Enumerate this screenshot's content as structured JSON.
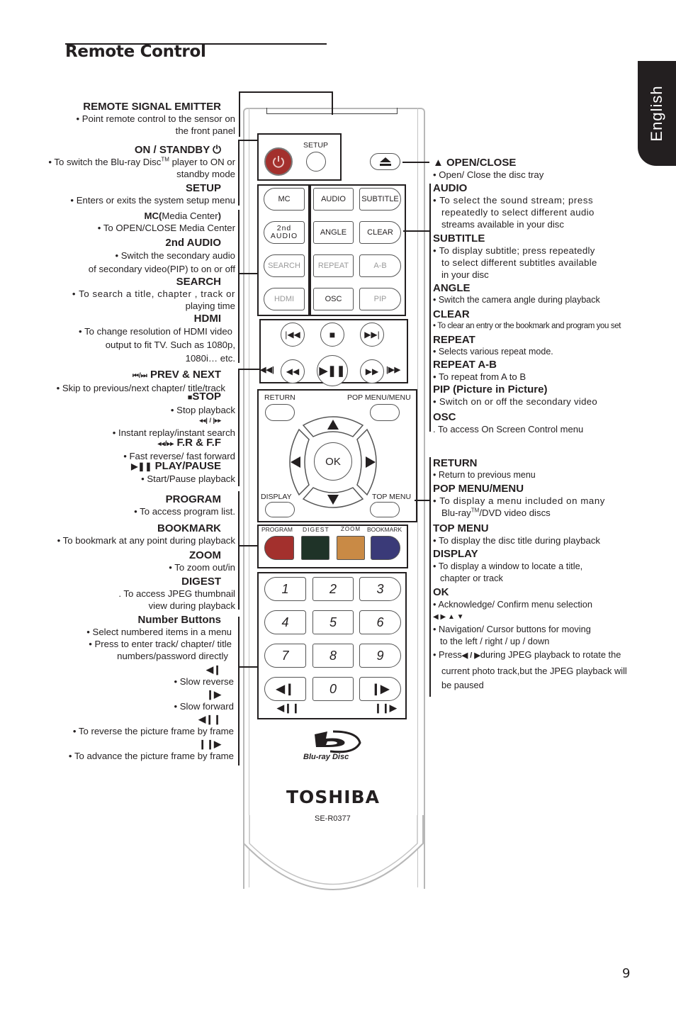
{
  "page": {
    "title": "Remote Control",
    "language_tab": "English",
    "page_number": "9"
  },
  "remote": {
    "setup_label": "SETUP",
    "buttons_left": [
      "MC",
      "2nd AUDIO",
      "SEARCH",
      "HDMI"
    ],
    "mc": "MC",
    "second_audio_1": "2nd",
    "second_audio_2": "AUDIO",
    "search": "SEARCH",
    "hdmi": "HDMI",
    "audio": "AUDIO",
    "subtitle": "SUBTITLE",
    "angle": "ANGLE",
    "clear": "CLEAR",
    "repeat": "REPEAT",
    "ab": "A-B",
    "osc": "OSC",
    "pip": "PIP",
    "return": "RETURN",
    "pop_menu": "POP MENU/MENU",
    "display": "DISPLAY",
    "top_menu": "TOP MENU",
    "ok": "OK",
    "program": "PROGRAM",
    "digest": "DIGEST",
    "zoom": "ZOOM",
    "bookmark": "BOOKMARK",
    "colors": {
      "program": "#a3302d",
      "digest": "#1f3328",
      "zoom": "#c98a45",
      "bookmark": "#3a3a78",
      "power": "#a3302d"
    },
    "digits": [
      "1",
      "2",
      "3",
      "4",
      "5",
      "6",
      "7",
      "8",
      "9",
      "0"
    ],
    "bluray_logo": "Blu-ray Disc",
    "brand": "TOSHIBA",
    "model": "SE-R0377"
  },
  "left": {
    "emitter": {
      "title": "REMOTE SIGNAL EMITTER",
      "l1": "• Point remote control to the sensor on",
      "l2": "the front panel"
    },
    "standby": {
      "title": "ON / STANDBY",
      "l1a": "•  To switch the  Blu-ray Disc",
      "tm": "TM",
      "l1b": " player to ON or",
      "l2": "standby mode"
    },
    "setup": {
      "title": "SETUP",
      "l1": "•    Enters or exits the system setup menu"
    },
    "mc": {
      "title_b": "MC(",
      "title_n": "Media Center",
      "title_e": ")",
      "l1": "• To OPEN/CLOSE Media Center"
    },
    "audio2": {
      "title": "2nd AUDIO",
      "l1": "•   Switch the secondary audio",
      "l2": "of secondary video(PIP) to on or off"
    },
    "search": {
      "title": "SEARCH",
      "l1": "• To search a title, chapter , track or",
      "l2": "playing time"
    },
    "hdmi": {
      "title": "HDMI",
      "l1": "• To change resolution of HDMI video",
      "l2": "output to fit TV. Such as 1080p,",
      "l3": "1080i… etc."
    },
    "prevnext": {
      "icon": "⏮/⏭",
      "title": "PREV & NEXT",
      "l1": "•  Skip to previous/next chapter/ title/track"
    },
    "stop": {
      "title": "STOP",
      "l1": "• Stop playback"
    },
    "replay": {
      "icon": "◂◂| / |▸▸",
      "l1": "•   Instant replay/instant search"
    },
    "frff": {
      "icon": "◂◂/▸▸",
      "title": "F.R & F.F",
      "l1": "•   Fast reverse/ fast forward"
    },
    "playpause": {
      "icon": "▶❚❚",
      "title": "PLAY/PAUSE",
      "l1": "• Start/Pause playback"
    },
    "program": {
      "title": "PROGRAM",
      "l1": "• To access program list."
    },
    "bookmark": {
      "title": "BOOKMARK",
      "l1": "• To bookmark at any point during playback"
    },
    "zoom": {
      "title": "ZOOM",
      "l1": "• To zoom out/in"
    },
    "digest": {
      "title": "DIGEST",
      "l1": ". To access JPEG thumbnail",
      "l2": "view during playback"
    },
    "numbers": {
      "title": "Number Buttons",
      "l1": "•   Select numbered items in a menu",
      "l2": "•   Press to enter track/ chapter/ title",
      "l3": "numbers/password directly"
    },
    "slowrev": {
      "icon": "◀❙",
      "l1": "•   Slow reverse"
    },
    "slowfwd": {
      "icon": "❙▶",
      "l1": "•   Slow forward"
    },
    "framerev": {
      "icon": "◀❙❙",
      "l1": "•   To reverse the picture frame by frame"
    },
    "framefwd": {
      "icon": "❙❙▶",
      "l1": "•   To advance the picture frame by frame"
    }
  },
  "right": {
    "openclose": {
      "title": "▲ OPEN/CLOSE",
      "l1": "•  Open/ Close the disc tray"
    },
    "audio": {
      "title": "AUDIO",
      "l1": "• To select the sound stream; press",
      "l2": "repeatedly to select different audio",
      "l3": "streams available in your disc"
    },
    "subtitle": {
      "title": "SUBTITLE",
      "l1": "• To display subtitle; press repeatedly",
      "l2": "to select different subtitles available",
      "l3": "in your disc"
    },
    "angle": {
      "title": "ANGLE",
      "l1": "• Switch the camera angle during playback"
    },
    "clear": {
      "title": "CLEAR",
      "l1": "• To clear an entry or the bookmark and program you set"
    },
    "repeat": {
      "title": "REPEAT",
      "l1": "•  Selects various repeat mode."
    },
    "repeatab": {
      "title": "REPEAT A-B",
      "l1": "•  To repeat from A to B"
    },
    "pip": {
      "title": "PIP (Picture in Picture)",
      "l1": "•  Switch on or off the secondary video"
    },
    "osc": {
      "title": "OSC",
      "l1": ". To access On Screen Control menu"
    },
    "return": {
      "title": "RETURN",
      "l1": "•  Return to previous menu"
    },
    "popmenu": {
      "title": "POP MENU/MENU",
      "l1": "•  To display a menu included on many",
      "l2a": "Blu-ray",
      "tm": "TM",
      "l2b": "/DVD video discs"
    },
    "topmenu": {
      "title": "TOP MENU",
      "l1": "•  To display the disc title during playback"
    },
    "display": {
      "title": "DISPLAY",
      "l1": "• To display a window to locate a title,",
      "l2": "chapter or track"
    },
    "ok": {
      "title": "OK",
      "l1": "• Acknowledge/ Confirm menu selection"
    },
    "nav": {
      "icon": "◀ ▶ ▲ ▼",
      "l1": "• Navigation/ Cursor buttons for moving",
      "l2": "to the left / right / up / down",
      "l3a": "•  Press",
      "l3icon": "◀ / ▶",
      "l3b": "during JPEG playback to rotate the",
      "l4": "current photo track,but the JPEG playback will",
      "l5": "be paused"
    }
  }
}
